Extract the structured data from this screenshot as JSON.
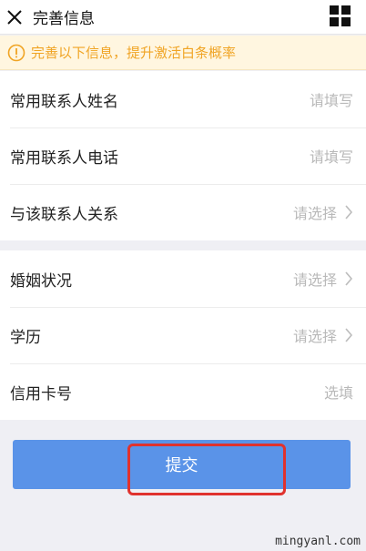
{
  "header": {
    "title": "完善信息"
  },
  "notice": {
    "text": "完善以下信息，提升激活白条概率"
  },
  "contact_group": {
    "rows": [
      {
        "label": "常用联系人姓名",
        "value": "请填写"
      },
      {
        "label": "常用联系人电话",
        "value": "请填写"
      },
      {
        "label": "与该联系人关系",
        "value": "请选择"
      }
    ]
  },
  "profile_group": {
    "rows": [
      {
        "label": "婚姻状况",
        "value": "请选择"
      },
      {
        "label": "学历",
        "value": "请选择"
      },
      {
        "label": "信用卡号",
        "value": "选填"
      }
    ]
  },
  "submit": {
    "label": "提交"
  },
  "watermark": {
    "text": "mingyanl.com"
  },
  "colors": {
    "accent": "#5a93e8",
    "notice_text": "#f0a424",
    "notice_bg": "#fff6e0",
    "highlight_outline": "#e0322e"
  }
}
